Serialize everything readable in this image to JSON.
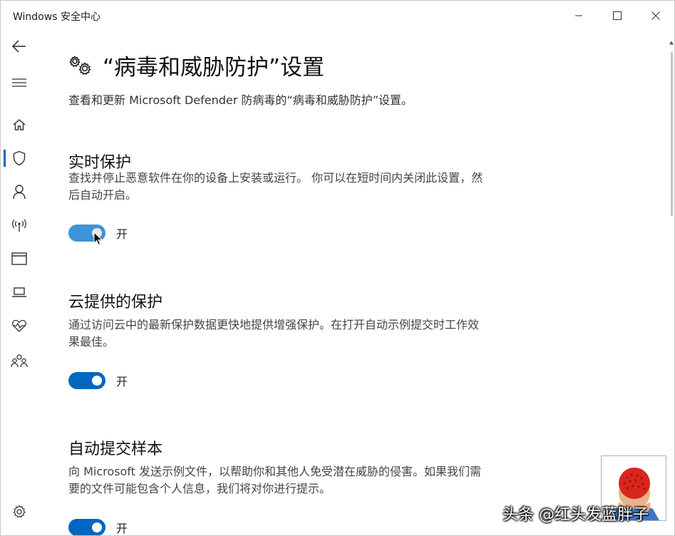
{
  "window": {
    "title": "Windows 安全中心"
  },
  "sidebar": {
    "items": [
      {
        "icon": "back-arrow-icon"
      },
      {
        "icon": "hamburger-menu-icon"
      },
      {
        "icon": "home-icon"
      },
      {
        "icon": "shield-icon",
        "active": true
      },
      {
        "icon": "person-icon"
      },
      {
        "icon": "wireless-antenna-icon"
      },
      {
        "icon": "browser-window-icon"
      },
      {
        "icon": "laptop-icon"
      },
      {
        "icon": "heart-pulse-icon"
      },
      {
        "icon": "family-icon"
      },
      {
        "icon": "gear-icon"
      }
    ]
  },
  "page": {
    "title": "“病毒和威胁防护”设置",
    "description": "查看和更新 Microsoft Defender 防病毒的“病毒和威胁防护”设置。"
  },
  "sections": [
    {
      "title": "实时保护",
      "description": "查找并停止恶意软件在你的设备上安装或运行。 你可以在短时间内关闭此设置，然后自动开启。",
      "toggle_label": "开",
      "toggle_on": true
    },
    {
      "title": "云提供的保护",
      "description": "通过访问云中的最新保护数据更快地提供增强保护。在打开自动示例提交时工作效果最佳。",
      "toggle_label": "开",
      "toggle_on": true
    },
    {
      "title": "自动提交样本",
      "description": "向 Microsoft 发送示例文件，以帮助你和其他人免受潜在威胁的侵害。如果我们需要的文件可能包含个人信息，我们将对你进行提示。",
      "toggle_label": "开",
      "toggle_on": true
    }
  ],
  "watermark": {
    "text": "头条 @红头发蓝胖子"
  },
  "colors": {
    "accent": "#0067c0",
    "accent_hover": "#3d94d6"
  }
}
